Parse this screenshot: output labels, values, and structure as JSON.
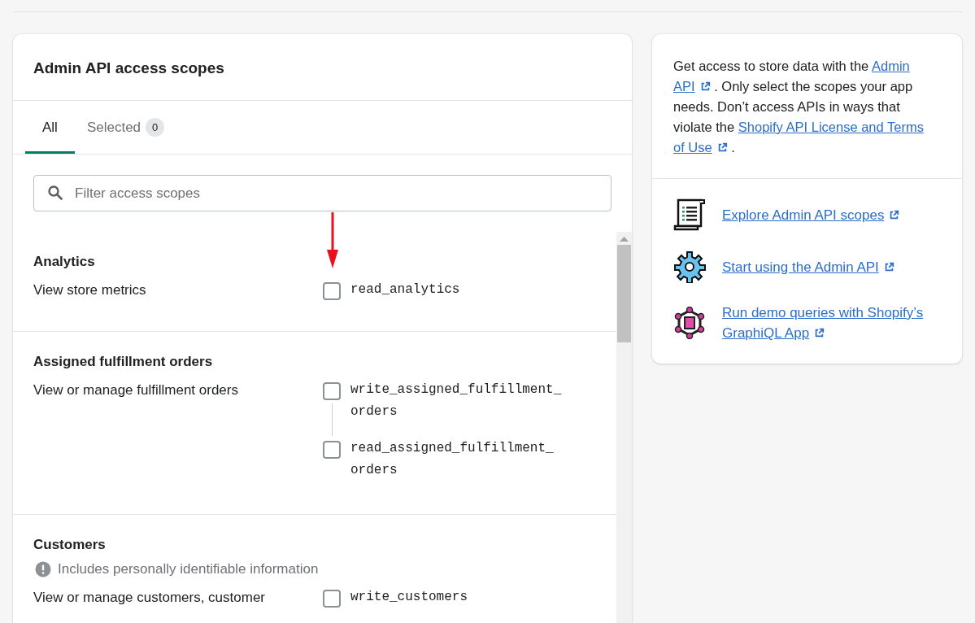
{
  "card_title": "Admin API access scopes",
  "tabs": [
    {
      "label": "All",
      "selected": true
    },
    {
      "label": "Selected",
      "count": "0",
      "selected": false
    }
  ],
  "search": {
    "placeholder": "Filter access scopes"
  },
  "sections": [
    {
      "title": "Analytics",
      "description": "View store metrics",
      "scopes": [
        {
          "name": "read_analytics",
          "checked": false
        }
      ]
    },
    {
      "title": "Assigned fulfillment orders",
      "description": "View or manage fulfillment orders",
      "scopes": [
        {
          "name": "write_assigned_fulfillment_orders",
          "checked": false
        },
        {
          "name": "read_assigned_fulfillment_orders",
          "checked": false
        }
      ]
    },
    {
      "title": "Customers",
      "warning": "Includes personally identifiable information",
      "description": "View or manage customers, customer",
      "scopes": [
        {
          "name": "write_customers",
          "checked": false
        }
      ]
    }
  ],
  "info": {
    "parts": [
      {
        "kind": "text",
        "text": "Get access to store data with the "
      },
      {
        "kind": "link",
        "text": "Admin"
      },
      {
        "kind": "link",
        "text": "API",
        "icon": true
      },
      {
        "kind": "text",
        "text": " . Only select the scopes your app needs. Don’t access APIs in ways that violate the "
      },
      {
        "kind": "link",
        "text": "Shopify API License and Terms"
      },
      {
        "kind": "link",
        "text": "of Use",
        "icon": true
      },
      {
        "kind": "text",
        "text": " ."
      }
    ]
  },
  "resources": [
    {
      "kind": "scroll",
      "label": "Explore Admin API scopes"
    },
    {
      "kind": "gear",
      "label": "Start using the Admin API"
    },
    {
      "kind": "graph",
      "label": "Run demo queries with Shopify’s GraphiQL App"
    }
  ]
}
